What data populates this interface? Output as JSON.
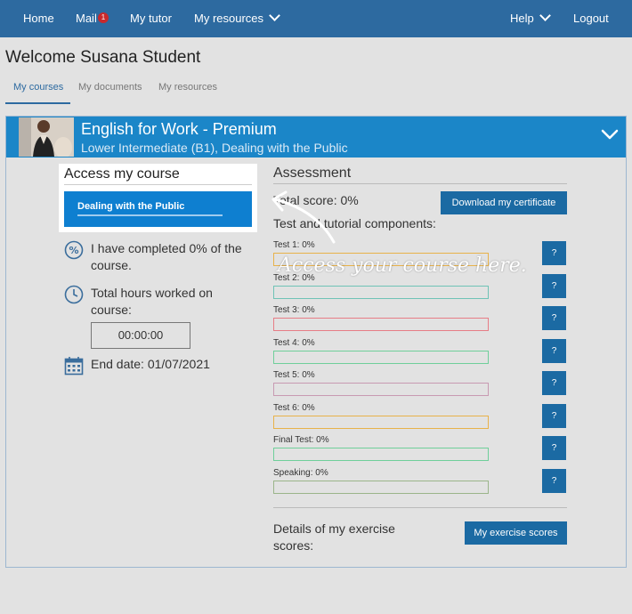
{
  "nav": {
    "home": "Home",
    "mail": "Mail",
    "mail_badge": "1",
    "tutor": "My tutor",
    "resources": "My resources",
    "help": "Help",
    "logout": "Logout"
  },
  "welcome": "Welcome Susana Student",
  "tabs": [
    "My courses",
    "My documents",
    "My resources"
  ],
  "course": {
    "title": "English for Work - Premium",
    "subtitle": "Lower Intermediate (B1), Dealing with the Public"
  },
  "access": {
    "title": "Access my course",
    "button": "Dealing with the Public"
  },
  "stats": {
    "completed": "I have completed 0% of the course.",
    "hours_label": "Total hours worked on course:",
    "hours_value": "00:00:00",
    "end_date": "End date: 01/07/2021"
  },
  "assessment": {
    "title": "Assessment",
    "total_score": "Total score: 0%",
    "certificate_button": "Download my certificate",
    "components_label": "Test and tutorial components:",
    "help_label": "?",
    "items": [
      {
        "label": "Test 1: 0%",
        "progress": 0,
        "color": "#e8b24a"
      },
      {
        "label": "Test 2: 0%",
        "progress": 0,
        "color": "#6fc3b6"
      },
      {
        "label": "Test 3: 0%",
        "progress": 0,
        "color": "#e77d86"
      },
      {
        "label": "Test 4: 0%",
        "progress": 0,
        "color": "#6fcf9a"
      },
      {
        "label": "Test 5: 0%",
        "progress": 0,
        "color": "#c89ab2"
      },
      {
        "label": "Test 6: 0%",
        "progress": 0,
        "color": "#e8b24a"
      },
      {
        "label": "Final Test: 0%",
        "progress": 0,
        "color": "#6fcf9a"
      },
      {
        "label": "Speaking: 0%",
        "progress": 0,
        "color": "#9bb58a"
      }
    ],
    "details_label": "Details of my exercise scores:",
    "scores_button": "My exercise scores"
  },
  "annotation": "Access your course here.",
  "colors": {
    "nav_bg": "#2d6aa0",
    "course_header": "#1b86c8",
    "access_button": "#0e7fd0",
    "button_blue": "#1b6aa3"
  }
}
